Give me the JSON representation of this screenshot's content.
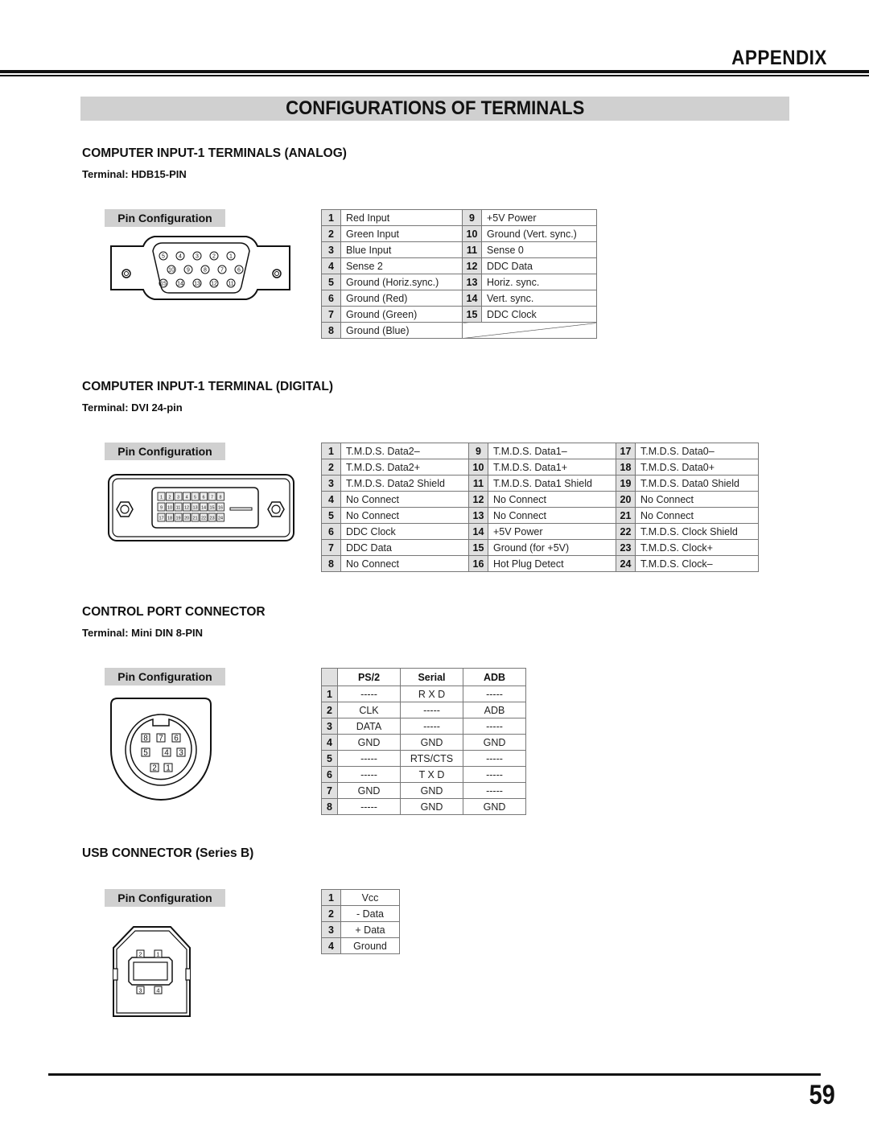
{
  "header": {
    "section_label": "APPENDIX",
    "page_title": "CONFIGURATIONS OF TERMINALS"
  },
  "pin_config_label": "Pin Configuration",
  "analog": {
    "title": "COMPUTER INPUT-1 TERMINALS (ANALOG)",
    "terminal": "Terminal: HDB15-PIN",
    "connector_pins": {
      "row1": [
        "5",
        "4",
        "3",
        "2",
        "1"
      ],
      "row2": [
        "10",
        "9",
        "8",
        "7",
        "6"
      ],
      "row3": [
        "15",
        "14",
        "13",
        "12",
        "11"
      ]
    },
    "rows": [
      {
        "n1": "1",
        "d1": "Red Input",
        "n2": "9",
        "d2": "+5V Power"
      },
      {
        "n1": "2",
        "d1": "Green Input",
        "n2": "10",
        "d2": "Ground (Vert. sync.)"
      },
      {
        "n1": "3",
        "d1": "Blue Input",
        "n2": "11",
        "d2": "Sense 0"
      },
      {
        "n1": "4",
        "d1": "Sense 2",
        "n2": "12",
        "d2": "DDC Data"
      },
      {
        "n1": "5",
        "d1": "Ground (Horiz.sync.)",
        "n2": "13",
        "d2": "Horiz. sync."
      },
      {
        "n1": "6",
        "d1": "Ground (Red)",
        "n2": "14",
        "d2": "Vert. sync."
      },
      {
        "n1": "7",
        "d1": "Ground (Green)",
        "n2": "15",
        "d2": "DDC Clock"
      },
      {
        "n1": "8",
        "d1": "Ground (Blue)",
        "n2": "",
        "d2": ""
      }
    ]
  },
  "digital": {
    "title": "COMPUTER INPUT-1 TERMINAL (DIGITAL)",
    "terminal": "Terminal: DVI 24-pin",
    "connector_pins": [
      [
        "1",
        "2",
        "3",
        "4",
        "5",
        "6",
        "7",
        "8"
      ],
      [
        "9",
        "10",
        "11",
        "12",
        "13",
        "14",
        "15",
        "16"
      ],
      [
        "17",
        "18",
        "19",
        "20",
        "21",
        "22",
        "23",
        "24"
      ]
    ],
    "rows": [
      {
        "n1": "1",
        "d1": "T.M.D.S. Data2–",
        "n2": "9",
        "d2": "T.M.D.S. Data1–",
        "n3": "17",
        "d3": "T.M.D.S. Data0–"
      },
      {
        "n1": "2",
        "d1": "T.M.D.S. Data2+",
        "n2": "10",
        "d2": "T.M.D.S. Data1+",
        "n3": "18",
        "d3": "T.M.D.S. Data0+"
      },
      {
        "n1": "3",
        "d1": "T.M.D.S. Data2 Shield",
        "n2": "11",
        "d2": "T.M.D.S. Data1 Shield",
        "n3": "19",
        "d3": "T.M.D.S. Data0 Shield"
      },
      {
        "n1": "4",
        "d1": "No Connect",
        "n2": "12",
        "d2": "No Connect",
        "n3": "20",
        "d3": "No Connect"
      },
      {
        "n1": "5",
        "d1": "No Connect",
        "n2": "13",
        "d2": "No Connect",
        "n3": "21",
        "d3": "No Connect"
      },
      {
        "n1": "6",
        "d1": "DDC Clock",
        "n2": "14",
        "d2": "+5V Power",
        "n3": "22",
        "d3": "T.M.D.S. Clock Shield"
      },
      {
        "n1": "7",
        "d1": "DDC Data",
        "n2": "15",
        "d2": "Ground (for +5V)",
        "n3": "23",
        "d3": "T.M.D.S. Clock+"
      },
      {
        "n1": "8",
        "d1": "No Connect",
        "n2": "16",
        "d2": "Hot Plug Detect",
        "n3": "24",
        "d3": "T.M.D.S. Clock–"
      }
    ]
  },
  "control": {
    "title": "CONTROL PORT CONNECTOR",
    "terminal": "Terminal: Mini DIN 8-PIN",
    "connector_pins": [
      "8",
      "7",
      "6",
      "5",
      "4",
      "3",
      "2",
      "1"
    ],
    "headers": [
      "PS/2",
      "Serial",
      "ADB"
    ],
    "rows": [
      {
        "n": "1",
        "ps2": "-----",
        "serial": "R X D",
        "adb": "-----"
      },
      {
        "n": "2",
        "ps2": "CLK",
        "serial": "-----",
        "adb": "ADB"
      },
      {
        "n": "3",
        "ps2": "DATA",
        "serial": "-----",
        "adb": "-----"
      },
      {
        "n": "4",
        "ps2": "GND",
        "serial": "GND",
        "adb": "GND"
      },
      {
        "n": "5",
        "ps2": "-----",
        "serial": "RTS/CTS",
        "adb": "-----"
      },
      {
        "n": "6",
        "ps2": "-----",
        "serial": "T X D",
        "adb": "-----"
      },
      {
        "n": "7",
        "ps2": "GND",
        "serial": "GND",
        "adb": "-----"
      },
      {
        "n": "8",
        "ps2": "-----",
        "serial": "GND",
        "adb": "GND"
      }
    ]
  },
  "usb": {
    "title": "USB CONNECTOR (Series B)",
    "connector_pins": [
      "2",
      "1",
      "3",
      "4"
    ],
    "rows": [
      {
        "n": "1",
        "d": "Vcc"
      },
      {
        "n": "2",
        "d": "- Data"
      },
      {
        "n": "3",
        "d": "+ Data"
      },
      {
        "n": "4",
        "d": "Ground"
      }
    ]
  },
  "footer": {
    "page_number": "59"
  }
}
